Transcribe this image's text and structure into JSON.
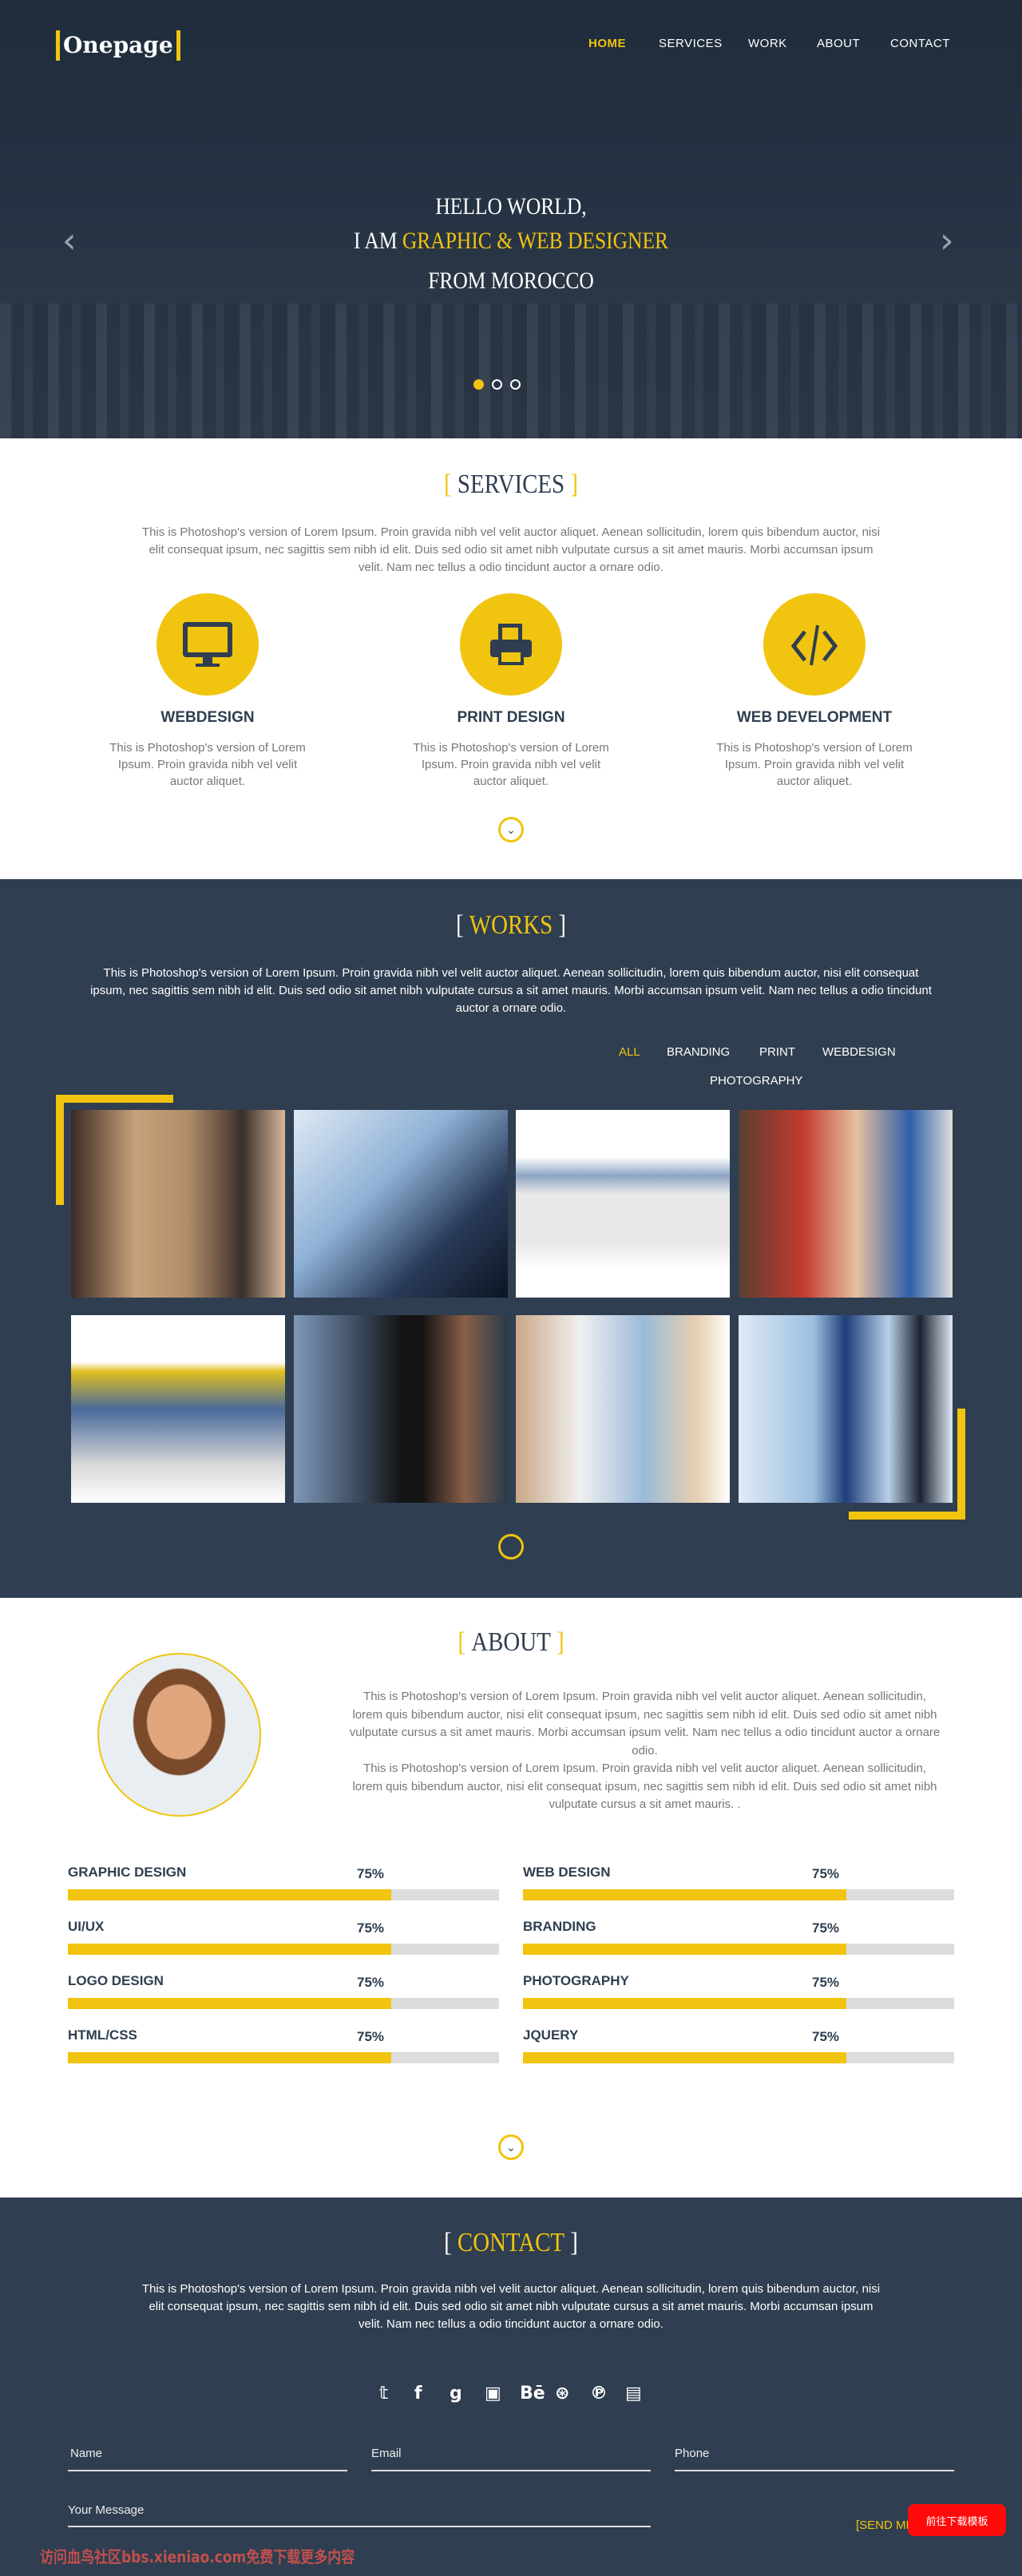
{
  "header": {
    "logo": "Onepage",
    "nav": [
      "HOME",
      "SERVICES",
      "WORK",
      "ABOUT",
      "CONTACT"
    ],
    "active": "HOME"
  },
  "hero": {
    "line1": "HELLO WORLD,",
    "line2_prefix": "I AM ",
    "line2_highlight": "GRAPHIC & WEB DESIGNER",
    "line3": "FROM MOROCCO",
    "slides": 3,
    "active_slide": 1
  },
  "colors": {
    "accent": "#f1c40f",
    "dark": "#2f3e50"
  },
  "services": {
    "title": "SERVICES",
    "bracket_open": "[",
    "bracket_close": "]",
    "intro": "This is Photoshop's version of Lorem Ipsum. Proin gravida nibh vel velit auctor aliquet. Aenean sollicitudin, lorem quis bibendum auctor, nisi elit consequat ipsum, nec sagittis sem nibh id elit. Duis sed odio sit amet nibh vulputate cursus a sit amet mauris. Morbi accumsan ipsum velit. Nam nec tellus a odio tincidunt auctor a ornare odio.",
    "items": [
      {
        "icon": "monitor-icon",
        "title": "WEBDESIGN",
        "text": "This is Photoshop's version of Lorem Ipsum. Proin gravida nibh vel velit auctor aliquet."
      },
      {
        "icon": "printer-icon",
        "title": "PRINT DESIGN",
        "text": "This is Photoshop's version of Lorem Ipsum. Proin gravida nibh vel velit auctor aliquet."
      },
      {
        "icon": "code-icon",
        "title": "WEB DEVELOPMENT",
        "text": "This is Photoshop's version of Lorem Ipsum. Proin gravida nibh vel velit auctor aliquet."
      }
    ]
  },
  "works": {
    "title": "WORKS",
    "intro": "This is Photoshop's version of Lorem Ipsum. Proin gravida nibh vel velit auctor aliquet. Aenean sollicitudin, lorem quis bibendum auctor, nisi elit consequat ipsum, nec sagittis sem nibh id elit. Duis sed odio sit amet nibh vulputate cursus a sit amet mauris. Morbi accumsan ipsum velit. Nam nec tellus a odio tincidunt auctor a ornare odio.",
    "filters": [
      "ALL",
      "BRANDING",
      "PRINT",
      "WEBDESIGN",
      "PHOTOGRAPHY"
    ],
    "active_filter": "ALL"
  },
  "about": {
    "title": "ABOUT",
    "para1": "This is Photoshop's version of Lorem Ipsum. Proin gravida nibh vel velit auctor aliquet. Aenean sollicitudin, lorem quis bibendum auctor, nisi elit consequat ipsum, nec sagittis sem nibh id elit. Duis sed odio sit amet nibh vulputate cursus a sit amet mauris. Morbi accumsan ipsum velit. Nam nec tellus a odio tincidunt auctor a ornare odio.",
    "para2": "This is Photoshop's version of Lorem Ipsum. Proin gravida nibh vel velit auctor aliquet. Aenean sollicitudin, lorem quis bibendum auctor, nisi elit consequat ipsum, nec sagittis sem nibh id elit. Duis sed odio sit amet nibh vulputate cursus a sit amet mauris. .",
    "skills": [
      {
        "name": "GRAPHIC DESIGN",
        "percent": "75%",
        "value": 75
      },
      {
        "name": "WEB DESIGN",
        "percent": "75%",
        "value": 75
      },
      {
        "name": "UI/UX",
        "percent": "75%",
        "value": 75
      },
      {
        "name": "BRANDING",
        "percent": "75%",
        "value": 75
      },
      {
        "name": "LOGO DESIGN",
        "percent": "75%",
        "value": 75
      },
      {
        "name": "PHOTOGRAPHY",
        "percent": "75%",
        "value": 75
      },
      {
        "name": "HTML/CSS",
        "percent": "75%",
        "value": 75
      },
      {
        "name": "JQUERY",
        "percent": "75%",
        "value": 75
      }
    ]
  },
  "contact": {
    "title": "CONTACT",
    "intro": "This is Photoshop's version of Lorem Ipsum. Proin gravida nibh vel velit auctor aliquet. Aenean sollicitudin, lorem quis bibendum auctor, nisi elit consequat ipsum, nec sagittis sem nibh id elit. Duis sed odio sit amet nibh vulputate cursus a sit amet mauris. Morbi accumsan ipsum velit. Nam nec tellus a odio tincidunt auctor a ornare odio.",
    "social": [
      "twitter-icon",
      "facebook-icon",
      "google-plus-icon",
      "youtube-icon",
      "behance-icon",
      "dribbble-icon",
      "pinterest-icon",
      "deviantart-icon"
    ],
    "social_glyphs": [
      "𝕥",
      "f",
      "g",
      "▣",
      "Bē",
      "⊛",
      "℗",
      "▤"
    ],
    "name_placeholder": "Name",
    "email_placeholder": "Email",
    "phone_placeholder": "Phone",
    "message_placeholder": "Your Message",
    "send": "[SEND MESSAGE]"
  },
  "overlay": {
    "download_button": "前往下载模板",
    "watermark": "访问血鸟社区bbs.xieniao.com免费下载更多内容"
  }
}
